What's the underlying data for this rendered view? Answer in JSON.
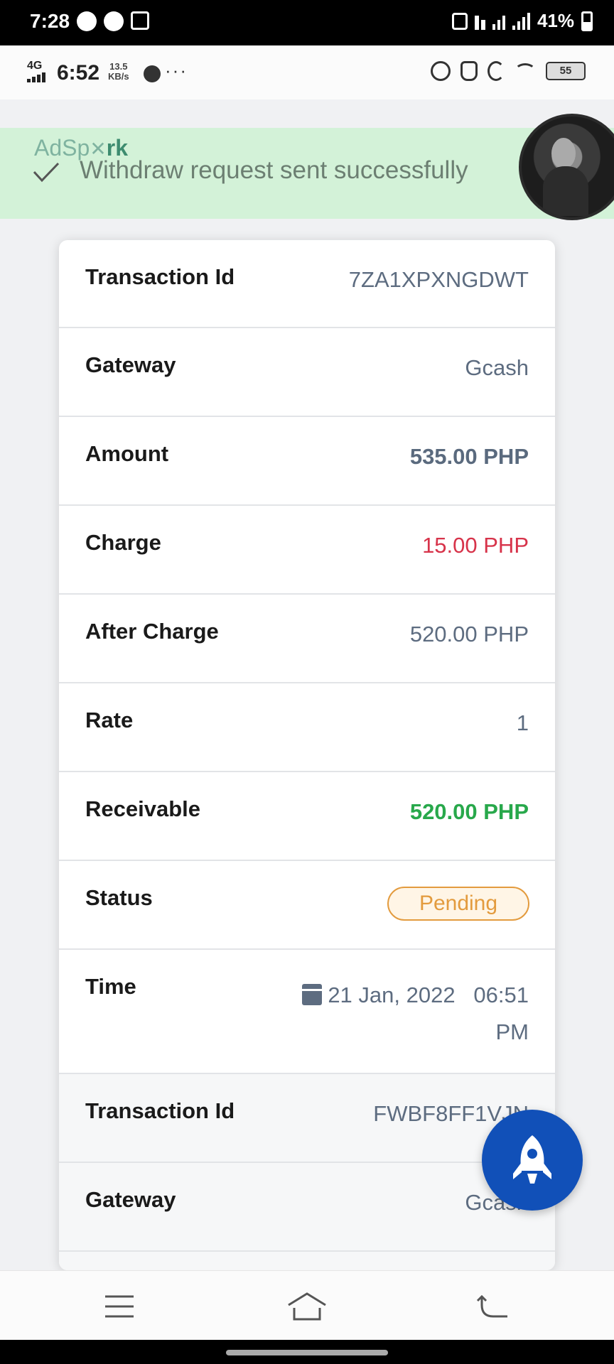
{
  "system_status": {
    "time": "7:28",
    "battery": "41%"
  },
  "inner_status": {
    "network": "4G",
    "time": "6:52",
    "speed_value": "13.5",
    "speed_unit": "KB/s",
    "more": "···",
    "battery": "55"
  },
  "banner": {
    "brand_prefix": "AdSp",
    "brand_suffix": "rk",
    "message": "Withdraw request sent successfully"
  },
  "transaction_1": {
    "transaction_id_label": "Transaction Id",
    "transaction_id": "7ZA1XPXNGDWT",
    "gateway_label": "Gateway",
    "gateway": "Gcash",
    "amount_label": "Amount",
    "amount": "535.00 PHP",
    "charge_label": "Charge",
    "charge": "15.00 PHP",
    "after_charge_label": "After Charge",
    "after_charge": "520.00 PHP",
    "rate_label": "Rate",
    "rate": "1",
    "receivable_label": "Receivable",
    "receivable": "520.00 PHP",
    "status_label": "Status",
    "status": "Pending",
    "time_label": "Time",
    "date": "21 Jan, 2022",
    "time": "06:51",
    "period": "PM"
  },
  "transaction_2": {
    "transaction_id_label": "Transaction Id",
    "transaction_id": "FWBF8FF1VJN",
    "gateway_label": "Gateway",
    "gateway": "Gcash"
  },
  "colors": {
    "banner_bg": "#d3f2d8",
    "charge_red": "#d7334a",
    "receivable_green": "#28a84b",
    "pending_orange": "#e39b3e",
    "fab_blue": "#1150b8"
  }
}
